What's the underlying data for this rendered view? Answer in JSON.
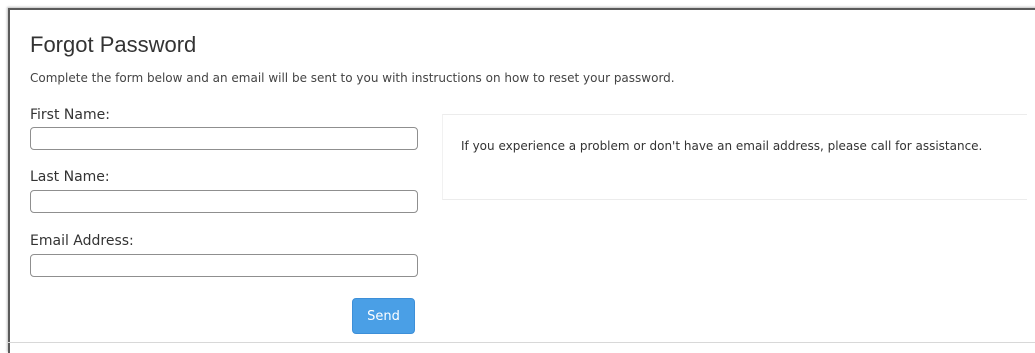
{
  "form": {
    "title": "Forgot Password",
    "description": "Complete the form below and an email will be sent to you with instructions on how to reset your password.",
    "fields": [
      {
        "label": "First Name:",
        "value": ""
      },
      {
        "label": "Last Name:",
        "value": ""
      },
      {
        "label": "Email Address:",
        "value": ""
      }
    ],
    "send_label": "Send"
  },
  "info": {
    "text": "If you experience a problem or don't have an email address, please call for assistance."
  },
  "colors": {
    "button_background": "#4a9fe6",
    "button_text": "#ffffff"
  }
}
